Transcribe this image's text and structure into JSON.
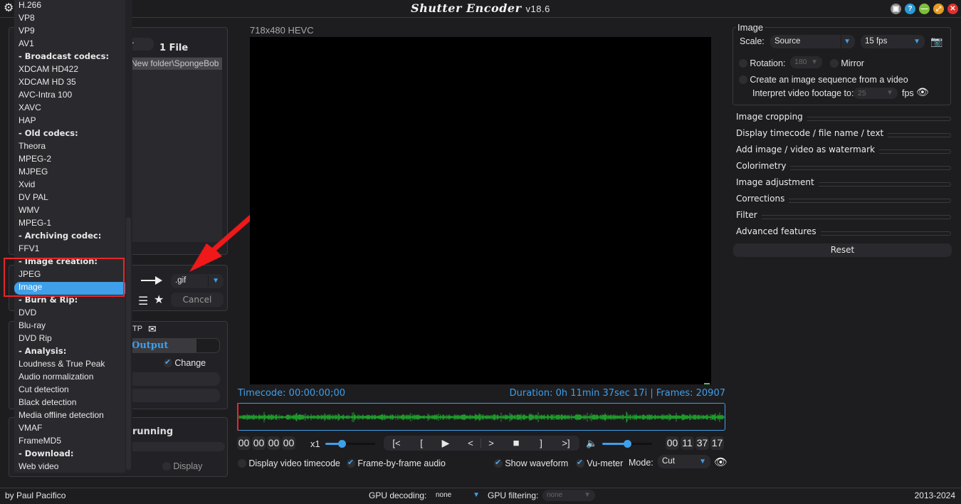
{
  "titlebar": {
    "title": "Shutter Encoder",
    "version": "v18.6",
    "buttons": [
      "window-icon",
      "help-icon",
      "minimize-icon",
      "fullscreen-icon",
      "close-icon"
    ]
  },
  "dropdown": {
    "items": [
      {
        "label": "H.266",
        "type": "item"
      },
      {
        "label": "VP8",
        "type": "item"
      },
      {
        "label": "VP9",
        "type": "item"
      },
      {
        "label": "AV1",
        "type": "item"
      },
      {
        "label": "- Broadcast codecs:",
        "type": "header"
      },
      {
        "label": "XDCAM HD422",
        "type": "item"
      },
      {
        "label": "XDCAM HD 35",
        "type": "item"
      },
      {
        "label": "AVC-Intra 100",
        "type": "item"
      },
      {
        "label": "XAVC",
        "type": "item"
      },
      {
        "label": "HAP",
        "type": "item"
      },
      {
        "label": "- Old codecs:",
        "type": "header"
      },
      {
        "label": "Theora",
        "type": "item"
      },
      {
        "label": "MPEG-2",
        "type": "item"
      },
      {
        "label": "MJPEG",
        "type": "item"
      },
      {
        "label": "Xvid",
        "type": "item"
      },
      {
        "label": "DV PAL",
        "type": "item"
      },
      {
        "label": "WMV",
        "type": "item"
      },
      {
        "label": "MPEG-1",
        "type": "item"
      },
      {
        "label": "- Archiving codec:",
        "type": "header"
      },
      {
        "label": "FFV1",
        "type": "item"
      },
      {
        "label": "- Image creation:",
        "type": "header"
      },
      {
        "label": "JPEG",
        "type": "item"
      },
      {
        "label": "Image",
        "type": "selected"
      },
      {
        "label": "- Burn & Rip:",
        "type": "header"
      },
      {
        "label": "DVD",
        "type": "item"
      },
      {
        "label": "Blu-ray",
        "type": "item"
      },
      {
        "label": "DVD Rip",
        "type": "item"
      },
      {
        "label": "- Analysis:",
        "type": "header"
      },
      {
        "label": "Loudness & True Peak",
        "type": "item"
      },
      {
        "label": "Audio normalization",
        "type": "item"
      },
      {
        "label": "Cut detection",
        "type": "item"
      },
      {
        "label": "Black detection",
        "type": "item"
      },
      {
        "label": "Media offline detection",
        "type": "item"
      },
      {
        "label": "VMAF",
        "type": "item"
      },
      {
        "label": "FrameMD5",
        "type": "item"
      },
      {
        "label": "- Download:",
        "type": "header"
      },
      {
        "label": "Web video",
        "type": "item"
      }
    ]
  },
  "files": {
    "browse_partial": "r",
    "count_label": "1 File",
    "file_path_partial": "New folder\\SpongeBob"
  },
  "output": {
    "extension": ".gif",
    "cancel_label": "Cancel",
    "ftp_partial": "TP",
    "output_tab_partial": "Output",
    "change_label": "Change",
    "running_partial": "running",
    "display_label": "Display"
  },
  "preview": {
    "video_info": "718x480 HEVC",
    "timecode": "Timecode: 00:00:00;00",
    "duration": "Duration: 0h 11min 37sec 17i | Frames: 20907",
    "in_tc": [
      "00",
      "00",
      "00",
      "00"
    ],
    "out_tc": [
      "00",
      "11",
      "37",
      "17"
    ],
    "speed_label": "x1",
    "speed_fraction": 0.33,
    "volume_fraction": 0.5,
    "transport": [
      "[<",
      "[",
      "▶",
      "<",
      ">",
      "■",
      "]",
      ">]"
    ],
    "display_video_timecode": {
      "label": "Display video timecode",
      "checked": false
    },
    "frame_by_frame_audio": {
      "label": "Frame-by-frame audio",
      "checked": true
    },
    "show_waveform": {
      "label": "Show waveform",
      "checked": true
    },
    "vu_meter": {
      "label": "Vu-meter",
      "checked": true
    },
    "mode_label": "Mode:",
    "mode_value": "Cut"
  },
  "image_panel": {
    "title": "Image",
    "scale_label": "Scale:",
    "scale_value": "Source",
    "fps_value": "15 fps",
    "rotation_label": "Rotation:",
    "rotation_value": "180",
    "mirror_label": "Mirror",
    "sequence_label": "Create an image sequence from a video",
    "interpret_label": "Interpret video footage to:",
    "interpret_value": "25",
    "fps_suffix": "fps"
  },
  "sections": [
    "Image cropping",
    "Display timecode / file name / text",
    "Add image / video as watermark",
    "Colorimetry",
    "Image adjustment",
    "Corrections",
    "Filter",
    "Advanced features"
  ],
  "reset_label": "Reset",
  "footer": {
    "author": "by Paul Pacifico",
    "gpu_decoding_label": "GPU decoding:",
    "gpu_decoding_value": "none",
    "gpu_filtering_label": "GPU filtering:",
    "gpu_filtering_value": "none",
    "years": "2013-2024"
  },
  "colors": {
    "accent": "#3f9fe8",
    "highlight": "#e8262a",
    "waveform": "#1f9a2a",
    "background": "#1d1d20"
  }
}
